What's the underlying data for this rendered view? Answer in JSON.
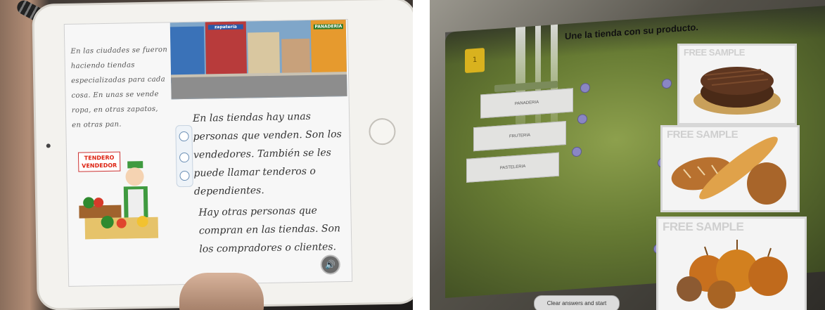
{
  "left_panel": {
    "paragraph_1": "En las ciudades se fueron haciendo tiendas especializadas para cada cosa. En unas se vende ropa, en otras zapatos, en otras pan.",
    "paragraph_2": "En las tiendas hay unas personas que venden. Son los vendedores. También se les puede llamar tenderos o dependientes.",
    "paragraph_3": "Hay otras personas que compran en las tiendas. Son los compradores o clientes.",
    "label_line_1": "TENDERO",
    "label_line_2": "VENDEDOR",
    "street_sign_1": "zapatería",
    "street_sign_2": "PANADERÍA",
    "audio_icon": "speaker-icon"
  },
  "right_panel": {
    "instruction": "Une la tienda con su producto.",
    "shop_buttons": [
      "PANADERIA",
      "FRUTERIA",
      "PASTELERIA"
    ],
    "image_cards": [
      {
        "watermark": "FREE SAMPLE",
        "product": "chocolate-cake"
      },
      {
        "watermark": "FREE SAMPLE",
        "product": "bread"
      },
      {
        "watermark": "FREE SAMPLE",
        "product": "onions"
      }
    ],
    "bottom_button": "Clear answers and start",
    "menu_button_label": "1"
  },
  "colors": {
    "match_dot": "#8a86c4",
    "green_background": "#6b7d35",
    "yellow_button": "#d9b21e",
    "label_red": "#d21111"
  }
}
